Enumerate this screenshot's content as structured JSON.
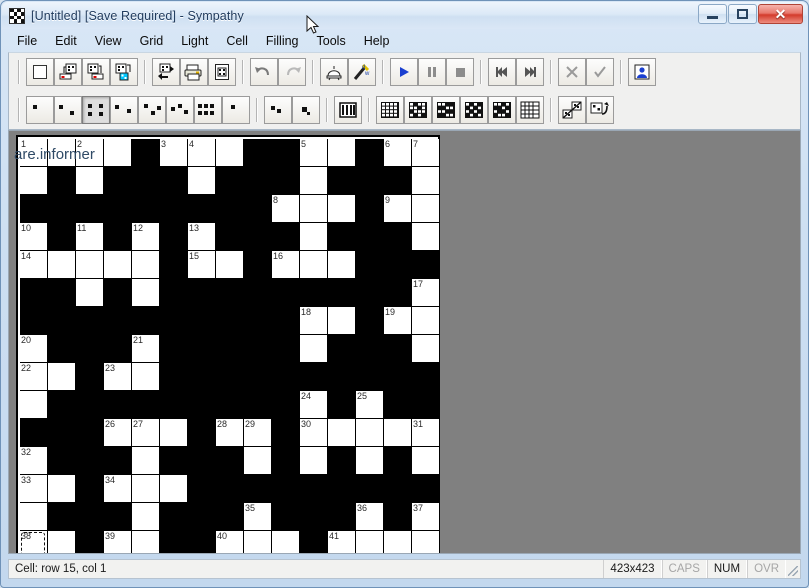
{
  "window": {
    "title": "[Untitled] [Save Required] - Sympathy",
    "app_icon": "crossword-grid-icon",
    "controls": {
      "minimize": "minimize",
      "maximize": "maximize",
      "close": "close"
    }
  },
  "menubar": [
    {
      "label": "File"
    },
    {
      "label": "Edit"
    },
    {
      "label": "View"
    },
    {
      "label": "Grid"
    },
    {
      "label": "Light"
    },
    {
      "label": "Cell"
    },
    {
      "label": "Filling"
    },
    {
      "label": "Tools"
    },
    {
      "label": "Help"
    }
  ],
  "toolbar_primary": [
    {
      "name": "new-grid-button",
      "icon": "blank-square-icon"
    },
    {
      "name": "open-grid-button",
      "icon": "open-grid-icon"
    },
    {
      "name": "save-grid-button",
      "icon": "save-grid-icon"
    },
    {
      "name": "save-as-grid-button",
      "icon": "save-as-grid-icon"
    },
    {
      "name": "export-button",
      "icon": "export-arrows-icon"
    },
    {
      "name": "print-button",
      "icon": "printer-icon"
    },
    {
      "name": "print-preview-button",
      "icon": "document-preview-icon"
    },
    {
      "name": "undo-button",
      "icon": "undo-arrow-icon"
    },
    {
      "name": "redo-button",
      "icon": "redo-arrow-icon"
    },
    {
      "name": "alarm-button",
      "icon": "bell-icon"
    },
    {
      "name": "autofill-wand-button",
      "icon": "magic-wand-icon"
    },
    {
      "name": "play-button",
      "icon": "play-triangle-icon"
    },
    {
      "name": "pause-button",
      "icon": "pause-bars-icon"
    },
    {
      "name": "stop-button",
      "icon": "stop-square-icon"
    },
    {
      "name": "first-button",
      "icon": "skip-back-icon"
    },
    {
      "name": "last-button",
      "icon": "skip-forward-icon"
    },
    {
      "name": "reject-button",
      "icon": "cross-icon"
    },
    {
      "name": "accept-button",
      "icon": "check-icon"
    },
    {
      "name": "user-button",
      "icon": "person-icon"
    }
  ],
  "toolbar_secondary": [
    {
      "name": "symmetry-none-button",
      "icon": "symmetry-none-icon"
    },
    {
      "name": "symmetry-diagonal-button",
      "icon": "symmetry-diagonal-icon"
    },
    {
      "name": "symmetry-180-button",
      "icon": "symmetry-180-icon",
      "pressed": true
    },
    {
      "name": "symmetry-horizontal-button",
      "icon": "symmetry-horizontal-icon"
    },
    {
      "name": "symmetry-vertical-button",
      "icon": "symmetry-vertical-icon"
    },
    {
      "name": "symmetry-left-right-button",
      "icon": "symmetry-left-right-icon"
    },
    {
      "name": "symmetry-quad-button",
      "icon": "symmetry-quad-icon"
    },
    {
      "name": "symmetry-corner-button",
      "icon": "symmetry-corner-icon"
    },
    {
      "name": "symmetry-half-button",
      "icon": "symmetry-half-icon"
    },
    {
      "name": "symmetry-step-button",
      "icon": "symmetry-step-icon"
    },
    {
      "name": "bars-grid-button",
      "icon": "bars-grid-icon"
    },
    {
      "name": "pattern-open-button",
      "icon": "pattern-open-icon"
    },
    {
      "name": "pattern-lattice-button",
      "icon": "pattern-lattice-icon"
    },
    {
      "name": "pattern-dense-button",
      "icon": "pattern-dense-icon"
    },
    {
      "name": "pattern-checker-button",
      "icon": "pattern-checker-icon"
    },
    {
      "name": "pattern-blocked-button",
      "icon": "pattern-blocked-icon"
    },
    {
      "name": "pattern-empty-button",
      "icon": "pattern-empty-icon"
    },
    {
      "name": "clear-pattern-button",
      "icon": "clear-pattern-icon"
    },
    {
      "name": "rotate-pattern-button",
      "icon": "rotate-pattern-icon"
    }
  ],
  "canvas": {
    "watermark": "are.informer"
  },
  "statusbar": {
    "message": "Cell: row 15, col 1",
    "size": "423x423",
    "caps": "CAPS",
    "num": "NUM",
    "ovr": "OVR"
  },
  "chart_data": {
    "type": "table",
    "title": "Crossword grid 15x15",
    "rows": 15,
    "cols": 15,
    "legend": {
      "w": "white/open cell",
      "b": "black/blocked cell"
    },
    "cursor": {
      "row": 15,
      "col": 1
    },
    "grid": [
      [
        "w",
        "w",
        "w",
        "w",
        "b",
        "w",
        "w",
        "w",
        "b",
        "b",
        "w",
        "w",
        "b",
        "w",
        "w"
      ],
      [
        "w",
        "b",
        "w",
        "b",
        "b",
        "b",
        "w",
        "b",
        "b",
        "b",
        "w",
        "b",
        "b",
        "b",
        "w"
      ],
      [
        "b",
        "b",
        "b",
        "b",
        "b",
        "b",
        "b",
        "b",
        "b",
        "w",
        "w",
        "w",
        "b",
        "w",
        "w"
      ],
      [
        "w",
        "b",
        "w",
        "b",
        "w",
        "b",
        "w",
        "b",
        "b",
        "b",
        "w",
        "b",
        "b",
        "b",
        "w"
      ],
      [
        "w",
        "w",
        "w",
        "w",
        "w",
        "b",
        "w",
        "w",
        "b",
        "w",
        "w",
        "w",
        "b",
        "b",
        "b"
      ],
      [
        "b",
        "b",
        "w",
        "b",
        "w",
        "b",
        "b",
        "b",
        "b",
        "b",
        "b",
        "b",
        "b",
        "b",
        "w"
      ],
      [
        "b",
        "b",
        "b",
        "b",
        "b",
        "b",
        "b",
        "b",
        "b",
        "b",
        "w",
        "w",
        "b",
        "w",
        "w"
      ],
      [
        "w",
        "b",
        "b",
        "b",
        "w",
        "b",
        "b",
        "b",
        "b",
        "b",
        "w",
        "b",
        "b",
        "b",
        "w"
      ],
      [
        "w",
        "w",
        "b",
        "w",
        "w",
        "b",
        "b",
        "b",
        "b",
        "b",
        "b",
        "b",
        "b",
        "b",
        "b"
      ],
      [
        "w",
        "b",
        "b",
        "b",
        "b",
        "b",
        "b",
        "b",
        "b",
        "b",
        "w",
        "b",
        "w",
        "b",
        "b"
      ],
      [
        "b",
        "b",
        "b",
        "w",
        "w",
        "w",
        "b",
        "w",
        "w",
        "b",
        "w",
        "w",
        "w",
        "w",
        "w"
      ],
      [
        "w",
        "b",
        "b",
        "b",
        "w",
        "b",
        "b",
        "b",
        "w",
        "b",
        "w",
        "b",
        "w",
        "b",
        "w"
      ],
      [
        "w",
        "w",
        "b",
        "w",
        "w",
        "w",
        "b",
        "b",
        "b",
        "b",
        "b",
        "b",
        "b",
        "b",
        "b"
      ],
      [
        "w",
        "b",
        "b",
        "b",
        "w",
        "b",
        "b",
        "b",
        "w",
        "b",
        "b",
        "b",
        "w",
        "b",
        "w"
      ],
      [
        "w",
        "w",
        "b",
        "w",
        "w",
        "b",
        "b",
        "w",
        "w",
        "w",
        "b",
        "w",
        "w",
        "w",
        "w"
      ]
    ],
    "numbers": [
      {
        "row": 1,
        "col": 1,
        "n": "1"
      },
      {
        "row": 1,
        "col": 3,
        "n": "2"
      },
      {
        "row": 1,
        "col": 6,
        "n": "3"
      },
      {
        "row": 1,
        "col": 7,
        "n": "4"
      },
      {
        "row": 1,
        "col": 11,
        "n": "5"
      },
      {
        "row": 1,
        "col": 14,
        "n": "6"
      },
      {
        "row": 1,
        "col": 15,
        "n": "7"
      },
      {
        "row": 3,
        "col": 10,
        "n": "8"
      },
      {
        "row": 3,
        "col": 14,
        "n": "9"
      },
      {
        "row": 4,
        "col": 1,
        "n": "10"
      },
      {
        "row": 4,
        "col": 3,
        "n": "11"
      },
      {
        "row": 4,
        "col": 5,
        "n": "12"
      },
      {
        "row": 4,
        "col": 7,
        "n": "13"
      },
      {
        "row": 5,
        "col": 1,
        "n": "14"
      },
      {
        "row": 5,
        "col": 7,
        "n": "15"
      },
      {
        "row": 5,
        "col": 10,
        "n": "16"
      },
      {
        "row": 6,
        "col": 15,
        "n": "17"
      },
      {
        "row": 7,
        "col": 11,
        "n": "18"
      },
      {
        "row": 7,
        "col": 14,
        "n": "19"
      },
      {
        "row": 8,
        "col": 1,
        "n": "20"
      },
      {
        "row": 8,
        "col": 5,
        "n": "21"
      },
      {
        "row": 9,
        "col": 1,
        "n": "22"
      },
      {
        "row": 9,
        "col": 4,
        "n": "23"
      },
      {
        "row": 10,
        "col": 11,
        "n": "24"
      },
      {
        "row": 10,
        "col": 13,
        "n": "25"
      },
      {
        "row": 11,
        "col": 4,
        "n": "26"
      },
      {
        "row": 11,
        "col": 5,
        "n": "27"
      },
      {
        "row": 11,
        "col": 8,
        "n": "28"
      },
      {
        "row": 11,
        "col": 9,
        "n": "29"
      },
      {
        "row": 11,
        "col": 11,
        "n": "30"
      },
      {
        "row": 11,
        "col": 15,
        "n": "31"
      },
      {
        "row": 12,
        "col": 1,
        "n": "32"
      },
      {
        "row": 13,
        "col": 1,
        "n": "33"
      },
      {
        "row": 13,
        "col": 4,
        "n": "34"
      },
      {
        "row": 14,
        "col": 9,
        "n": "35"
      },
      {
        "row": 14,
        "col": 13,
        "n": "36"
      },
      {
        "row": 14,
        "col": 15,
        "n": "37"
      },
      {
        "row": 15,
        "col": 1,
        "n": "38"
      },
      {
        "row": 15,
        "col": 4,
        "n": "39"
      },
      {
        "row": 15,
        "col": 8,
        "n": "40"
      },
      {
        "row": 15,
        "col": 12,
        "n": "41"
      }
    ]
  }
}
